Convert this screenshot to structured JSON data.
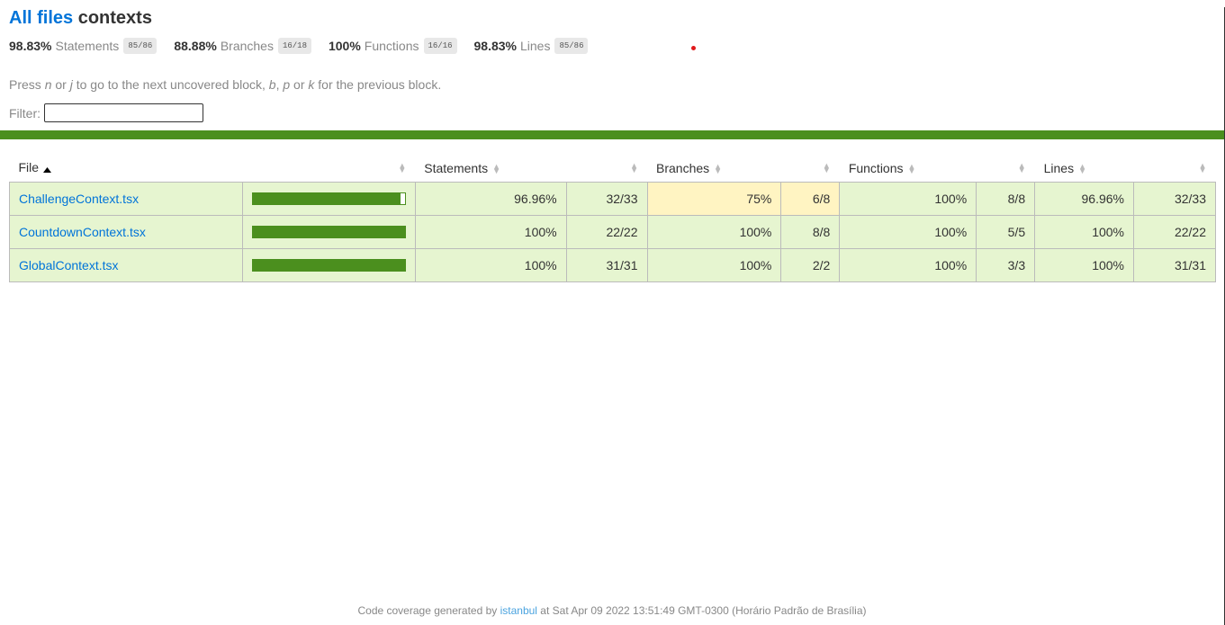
{
  "header": {
    "breadcrumb_link": "All files",
    "current_dir": "contexts"
  },
  "summary": [
    {
      "pct": "98.83%",
      "label": "Statements",
      "frac": "85/86"
    },
    {
      "pct": "88.88%",
      "label": "Branches",
      "frac": "16/18"
    },
    {
      "pct": "100%",
      "label": "Functions",
      "frac": "16/16"
    },
    {
      "pct": "98.83%",
      "label": "Lines",
      "frac": "85/86"
    }
  ],
  "hint": {
    "p1": "Press ",
    "k_n": "n",
    "p2": " or ",
    "k_j": "j",
    "p3": " to go to the next uncovered block, ",
    "k_b": "b",
    "p4": ", ",
    "k_p": "p",
    "p5": " or ",
    "k_k": "k",
    "p6": " for the previous block."
  },
  "filter": {
    "label": "Filter:",
    "value": ""
  },
  "table": {
    "headers": {
      "file": "File",
      "statements": "Statements",
      "branches": "Branches",
      "functions": "Functions",
      "lines": "Lines"
    },
    "rows": [
      {
        "file": "ChallengeContext.tsx",
        "coverage": 96.96,
        "stmt_pct": "96.96%",
        "stmt_frac": "32/33",
        "br_pct": "75%",
        "br_frac": "6/8",
        "fn_pct": "100%",
        "fn_frac": "8/8",
        "ln_pct": "96.96%",
        "ln_frac": "32/33"
      },
      {
        "file": "CountdownContext.tsx",
        "coverage": 100,
        "stmt_pct": "100%",
        "stmt_frac": "22/22",
        "br_pct": "100%",
        "br_frac": "8/8",
        "fn_pct": "100%",
        "fn_frac": "5/5",
        "ln_pct": "100%",
        "ln_frac": "22/22"
      },
      {
        "file": "GlobalContext.tsx",
        "coverage": 100,
        "stmt_pct": "100%",
        "stmt_frac": "31/31",
        "br_pct": "100%",
        "br_frac": "2/2",
        "fn_pct": "100%",
        "fn_frac": "3/3",
        "ln_pct": "100%",
        "ln_frac": "31/31"
      }
    ]
  },
  "footer": {
    "prefix": "Code coverage generated by ",
    "link": "istanbul",
    "suffix": " at Sat Apr 09 2022 13:51:49 GMT-0300 (Horário Padrão de Brasília)"
  },
  "colors": {
    "link": "#0074d9",
    "high_bg": "#e6f5d0",
    "medium_bg": "#fff4c2",
    "bar_green": "#4b8f1e"
  }
}
